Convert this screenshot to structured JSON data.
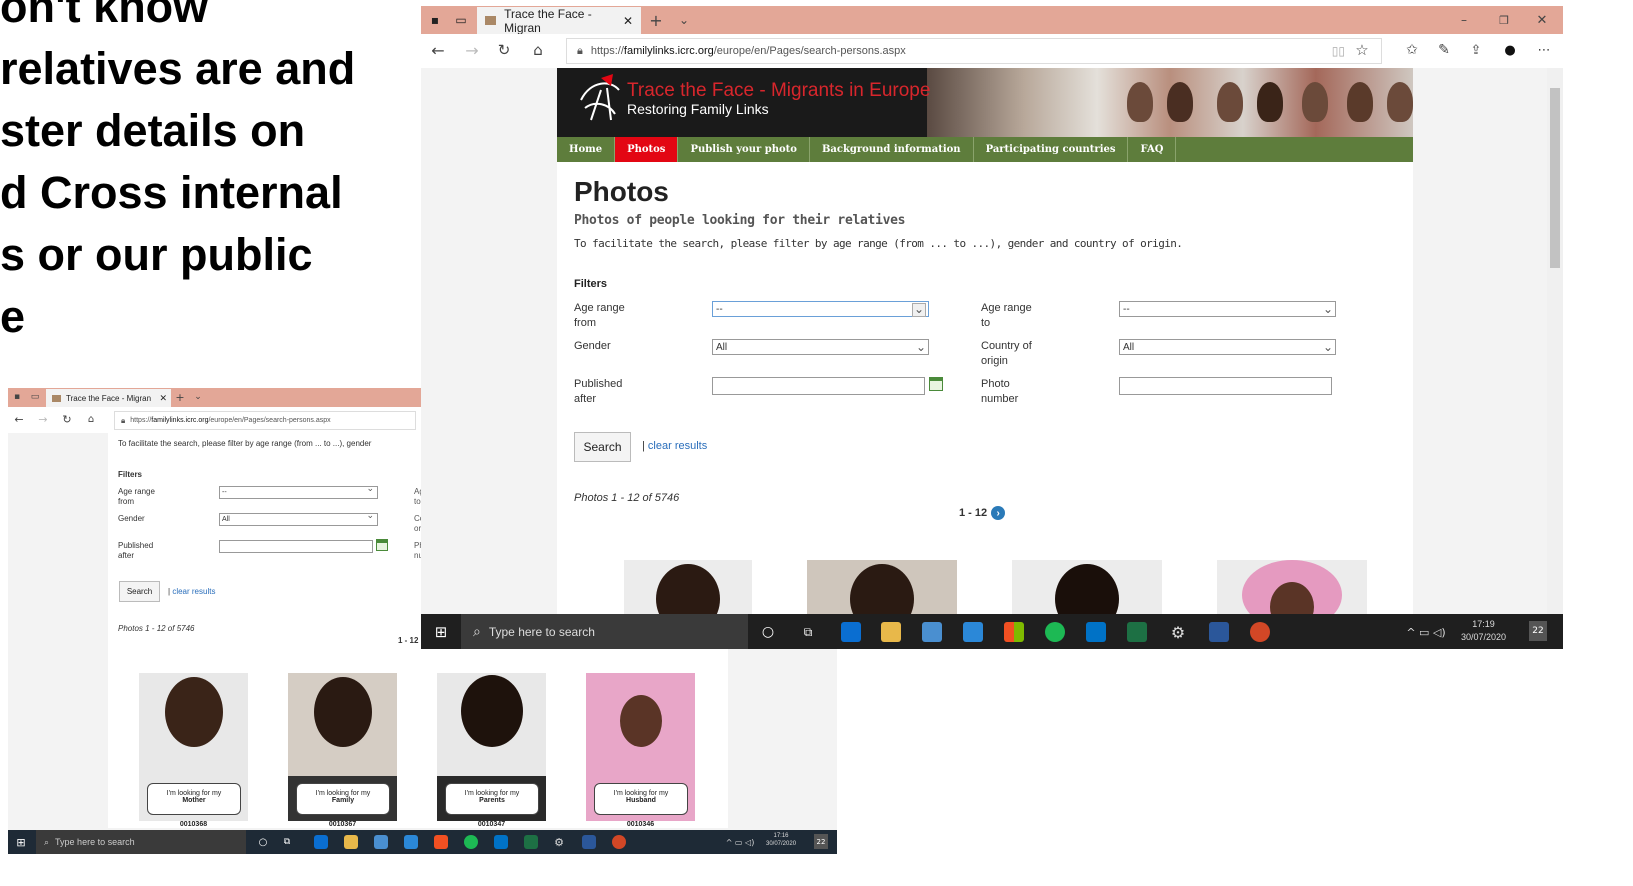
{
  "slide": {
    "lines": [
      "on't know",
      "relatives are and",
      "ster details on",
      "d Cross internal",
      "s or our public",
      "e"
    ]
  },
  "browser": {
    "tab_title": "Trace the Face - Migran",
    "url_prefix": "https://",
    "url_domain": "familylinks.icrc.org",
    "url_path": "/europe/en/Pages/search-persons.aspx"
  },
  "site": {
    "banner_title": "Trace the Face - Migrants in Europe",
    "banner_subtitle": "Restoring Family Links",
    "nav": [
      "Home",
      "Photos",
      "Publish your photo",
      "Background information",
      "Participating countries",
      "FAQ"
    ],
    "nav_active_color": "#e30613",
    "nav_color": "#5e7d3c",
    "heading": "Photos",
    "subheading": "Photos of people looking for their relatives",
    "intro": "To facilitate the search, please filter by age range (from ... to ...), gender and country of origin.",
    "filters_title": "Filters",
    "labels": {
      "age_from_1": "Age range",
      "age_from_2": "from",
      "age_to_1": "Age range",
      "age_to_2": "to",
      "gender": "Gender",
      "country_1": "Country of",
      "country_2": "origin",
      "published_1": "Published",
      "published_2": "after",
      "photo_1": "Photo",
      "photo_2": "number"
    },
    "values": {
      "age_from": "--",
      "age_to": "--",
      "gender": "All",
      "country": "All"
    },
    "search_button": "Search",
    "clear_separator": "|",
    "clear_results": "clear results",
    "results_count": "Photos 1 - 12 of 5746",
    "pager": "1 - 12"
  },
  "small_page": {
    "intro_truncated": "To facilitate the search, please filter by age range (from ... to ...), gender",
    "photos": [
      {
        "number": "0010368",
        "bubble_line1": "I'm looking for my",
        "bubble_line2": "Mother"
      },
      {
        "number": "0010367",
        "bubble_line1": "I'm looking for my",
        "bubble_line2": "Family"
      },
      {
        "number": "0010347",
        "bubble_line1": "I'm looking for my",
        "bubble_line2": "Parents"
      },
      {
        "number": "0010346",
        "bubble_line1": "I'm looking for my",
        "bubble_line2": "Husband"
      }
    ],
    "pager_partial": "1 - 12",
    "label_fragments": [
      "Ag",
      "to",
      "Co",
      "or",
      "Ph",
      "nu"
    ]
  },
  "taskbar": {
    "search_placeholder": "Type here to search",
    "time_big": "17:19",
    "date_big": "30/07/2020",
    "notif_count_big": "22",
    "time_small": "17:16",
    "date_small": "30/07/2020",
    "notif_count_small": "22"
  }
}
